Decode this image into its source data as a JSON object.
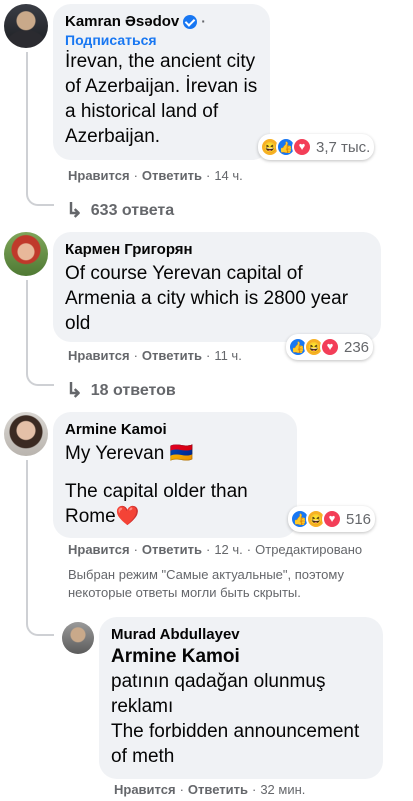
{
  "comments": [
    {
      "author": "Kamran Əsədov",
      "verified": true,
      "subscribe": "Подписаться",
      "text": "İrevan, the ancient city\nof Azerbaijan. İrevan is\na historical land of\nAzerbaijan.",
      "reaction_count": "3,7 тыс.",
      "reactions": [
        "haha-icon",
        "like-icon",
        "love-icon"
      ],
      "like": "Нравится",
      "reply": "Ответить",
      "time": "14 ч.",
      "replies": "633 ответа"
    },
    {
      "author": "Кармен Григорян",
      "text": "Of course Yerevan capital of\nArmenia a city which is 2800 year\nold",
      "reaction_count": "236",
      "reactions": [
        "like-icon",
        "haha-icon",
        "love-icon"
      ],
      "like": "Нравится",
      "reply": "Ответить",
      "time": "11 ч.",
      "replies": "18 ответов"
    },
    {
      "author": "Armine Kamoi",
      "text_line1": "My Yerevan 🇦🇲",
      "text_line2": "The capital older than\nRome❤️",
      "reaction_count": "516",
      "reactions": [
        "like-icon",
        "haha-icon",
        "love-icon"
      ],
      "like": "Нравится",
      "reply": "Ответить",
      "time": "12 ч.",
      "edited": "Отредактировано",
      "notice": "Выбран режим \"Самые актуальные\", поэтому некоторые ответы могли быть скрыты."
    }
  ],
  "reply": {
    "author": "Murad Abdullayev",
    "mention": "Armine Kamoi",
    "text": "patının qadağan olunmuş\nreklamı\nThe forbidden announcement\nof meth",
    "like": "Нравится",
    "reply": "Ответить",
    "time": "32 мин."
  },
  "colors": {
    "accent": "#1877f2",
    "bubble": "#f0f2f5",
    "secondary_text": "#65676b"
  }
}
